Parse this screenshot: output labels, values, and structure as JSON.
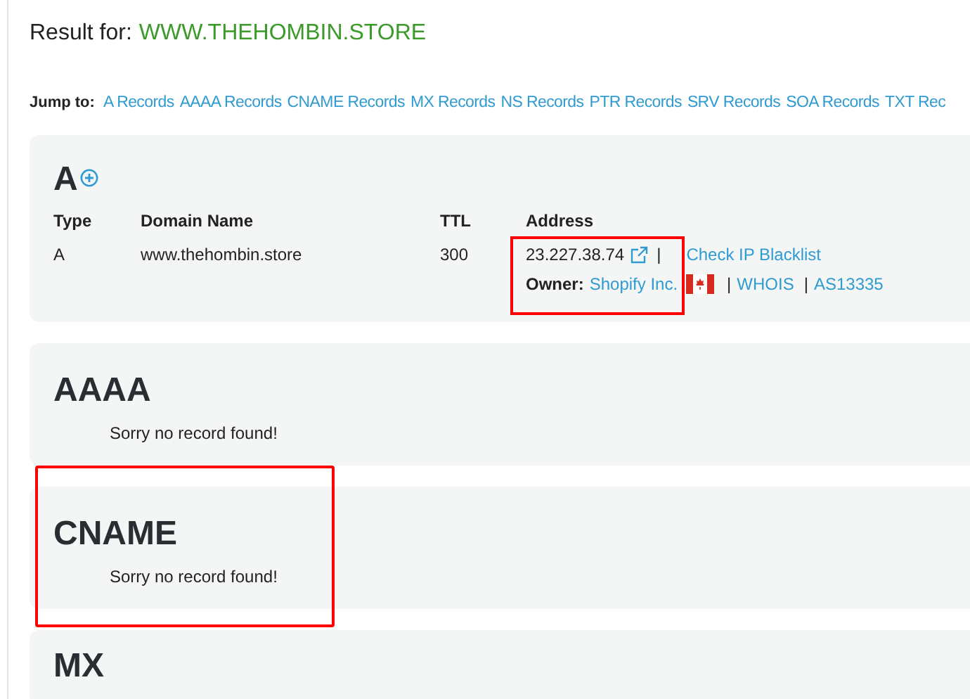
{
  "result": {
    "label": "Result for:",
    "domain": "WWW.THEHOMBIN.STORE"
  },
  "jump": {
    "label": "Jump to:",
    "links": [
      "A Records",
      "AAAA Records",
      "CNAME Records",
      "MX Records",
      "NS Records",
      "PTR Records",
      "SRV Records",
      "SOA Records",
      "TXT Rec"
    ]
  },
  "sections": [
    {
      "kind": "table",
      "title": "A",
      "highlighted": false,
      "columns": [
        "Type",
        "Domain Name",
        "TTL",
        "Address"
      ],
      "rows": [
        {
          "type": "A",
          "domain": "www.thehombin.store",
          "ttl": "300",
          "address": "23.227.38.74",
          "address_highlighted": true,
          "sep_1": "|",
          "blacklist": "Check IP Blacklist",
          "owner_label": "Owner:",
          "owner": "Shopify Inc.",
          "sep_2": "|",
          "whois": "WHOIS",
          "sep_3": "|",
          "asn": "AS13335"
        }
      ]
    },
    {
      "kind": "empty",
      "title": "AAAA",
      "highlighted": false,
      "message": "Sorry no record found!"
    },
    {
      "kind": "empty",
      "title": "CNAME",
      "highlighted": true,
      "message": "Sorry no record found!"
    },
    {
      "kind": "empty",
      "title": "MX",
      "highlighted": false
    }
  ]
}
